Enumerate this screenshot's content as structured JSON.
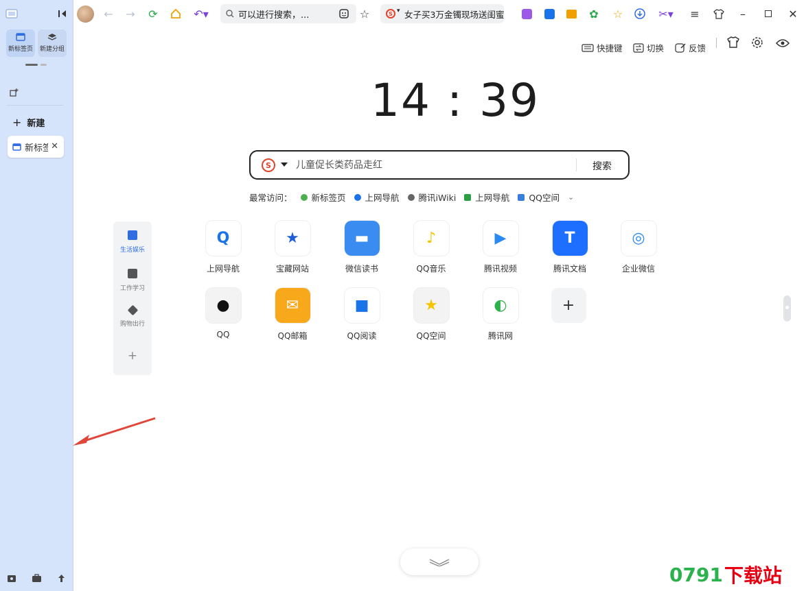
{
  "sidebar": {
    "buttons": [
      {
        "label": "新标签页"
      },
      {
        "label": "新建分组"
      }
    ],
    "new_label": "新建",
    "tab": {
      "title": "新标签"
    }
  },
  "toolbar": {
    "address_text": "可以进行搜索，...",
    "news_text": "女子买3万金镯现场送闺蜜"
  },
  "tools": {
    "shortcut": "快捷键",
    "switch": "切换",
    "feedback": "反馈"
  },
  "clock": {
    "time": "14 : 39"
  },
  "search": {
    "placeholder": "儿童促长类药品走红",
    "button": "搜索"
  },
  "frequent": {
    "label": "最常访问：",
    "items": [
      {
        "label": "新标签页",
        "color": "#4caf50"
      },
      {
        "label": "上网导航",
        "color": "#1a73e8"
      },
      {
        "label": "腾讯iWiki",
        "color": "#666666"
      },
      {
        "label": "上网导航",
        "color": "#2e9e44"
      },
      {
        "label": "QQ空间",
        "color": "#3b7ddd"
      }
    ]
  },
  "categories": [
    {
      "label": "生活娱乐",
      "color": "#2f6de1",
      "active": true
    },
    {
      "label": "工作学习",
      "color": "#555555",
      "active": false
    },
    {
      "label": "购物出行",
      "color": "#555555",
      "active": false
    }
  ],
  "apps_row1": [
    {
      "name": "上网导航",
      "bg": "#ffffff",
      "fg": "#1a73e8",
      "glyph": "Q"
    },
    {
      "name": "宝藏网站",
      "bg": "#ffffff",
      "fg": "#1f5fd6",
      "glyph": "★"
    },
    {
      "name": "微信读书",
      "bg": "#3b8cf0",
      "fg": "#ffffff",
      "glyph": "▬"
    },
    {
      "name": "QQ音乐",
      "bg": "#ffffff",
      "fg": "#f5c400",
      "glyph": "♪"
    },
    {
      "name": "腾讯视频",
      "bg": "#ffffff",
      "fg": "#2a8af4",
      "glyph": "▶"
    },
    {
      "name": "腾讯文档",
      "bg": "#1e6fff",
      "fg": "#ffffff",
      "glyph": "T"
    },
    {
      "name": "企业微信",
      "bg": "#ffffff",
      "fg": "#2a8af4",
      "glyph": "◎"
    }
  ],
  "apps_row2": [
    {
      "name": "QQ",
      "bg": "#ffffff",
      "fg": "#111111",
      "glyph": "●"
    },
    {
      "name": "QQ邮箱",
      "bg": "#f7a81b",
      "fg": "#ffffff",
      "glyph": "✉"
    },
    {
      "name": "QQ阅读",
      "bg": "#ffffff",
      "fg": "#1a73e8",
      "glyph": "■"
    },
    {
      "name": "QQ空间",
      "bg": "#ffffff",
      "fg": "#f5c400",
      "glyph": "★"
    },
    {
      "name": "腾讯网",
      "bg": "#ffffff",
      "fg": "#2bb24c",
      "glyph": "◐"
    }
  ],
  "watermark": {
    "num": "0791",
    "text": "下载站"
  }
}
